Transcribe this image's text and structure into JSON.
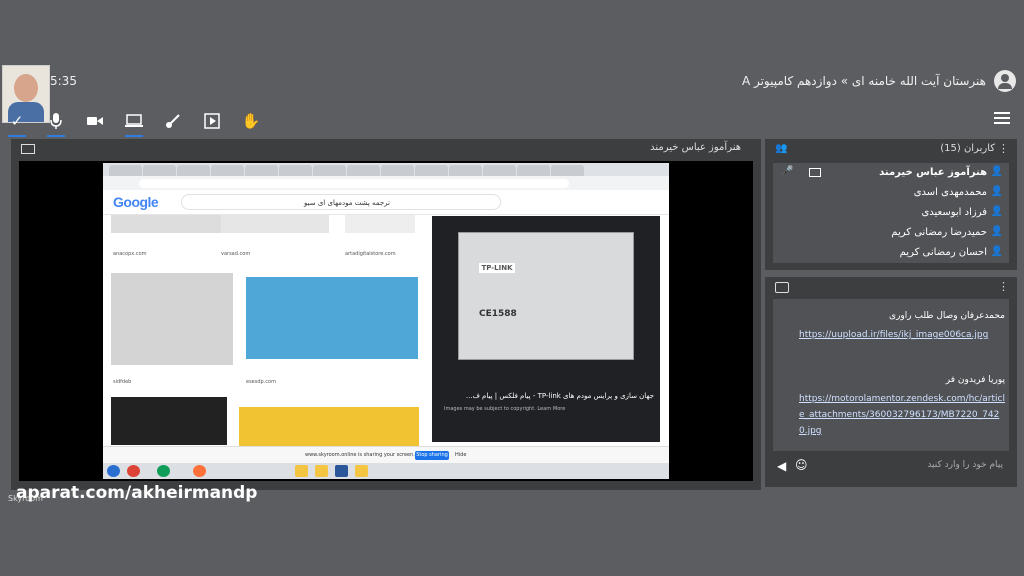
{
  "header": {
    "timer": "5:35",
    "room_title": "هنرستان آیت الله خامنه ای » دوازدهم کامپیوتر A",
    "toolbar_icons": [
      "check-icon",
      "mic-icon",
      "camera-icon",
      "screen-icon",
      "brush-icon",
      "play-icon",
      "hand-icon"
    ]
  },
  "stage": {
    "presenter": "هنرآموز عباس خیرمند",
    "browser": {
      "search_query": "ترجمه پشت مودمهای ای سیو",
      "logo": "Google",
      "captions": [
        "anacopx.com",
        "varsad.com",
        "artadigitalstore.com",
        "sidfdeb",
        "esesdp.com"
      ],
      "preview_title": "جهان سازی و پرایس مودم های TP-link - پیام فلکس | پیام ف...",
      "preview_note": "Images may be subject to copyright. Learn More",
      "preview_brand": "TP-LINK",
      "preview_ce": "CE1588",
      "share_text": "www.skyroom.online is sharing your screen.",
      "stop_label": "Stop sharing",
      "hide_label": "Hide"
    }
  },
  "users": {
    "title": "کاربران (15)",
    "list": [
      {
        "name": "هنرآموز عباس خیرمند",
        "active": true
      },
      {
        "name": "محمدمهدی اسدی",
        "active": false
      },
      {
        "name": "فرزاد ابوسعیدی",
        "active": false
      },
      {
        "name": "حمیدرضا رمضانی کریم",
        "active": false
      },
      {
        "name": "احسان رمضانی کریم",
        "active": false
      }
    ]
  },
  "chat": {
    "messages": [
      {
        "sender": "محمدعرفان وصال طلب راوری",
        "link": "https://uupload.ir/files/ikj_image006ca.jpg"
      },
      {
        "sender": "پوریا فریدون فر",
        "link": "https://motorolamentor.zendesk.com/hc/article_attachments/360032796173/MB7220_7420.jpg"
      }
    ],
    "input_placeholder": "پیام خود را وارد کنید"
  },
  "watermark": "aparat.com/akheirmandp",
  "skyroom_label": "Skyroom"
}
